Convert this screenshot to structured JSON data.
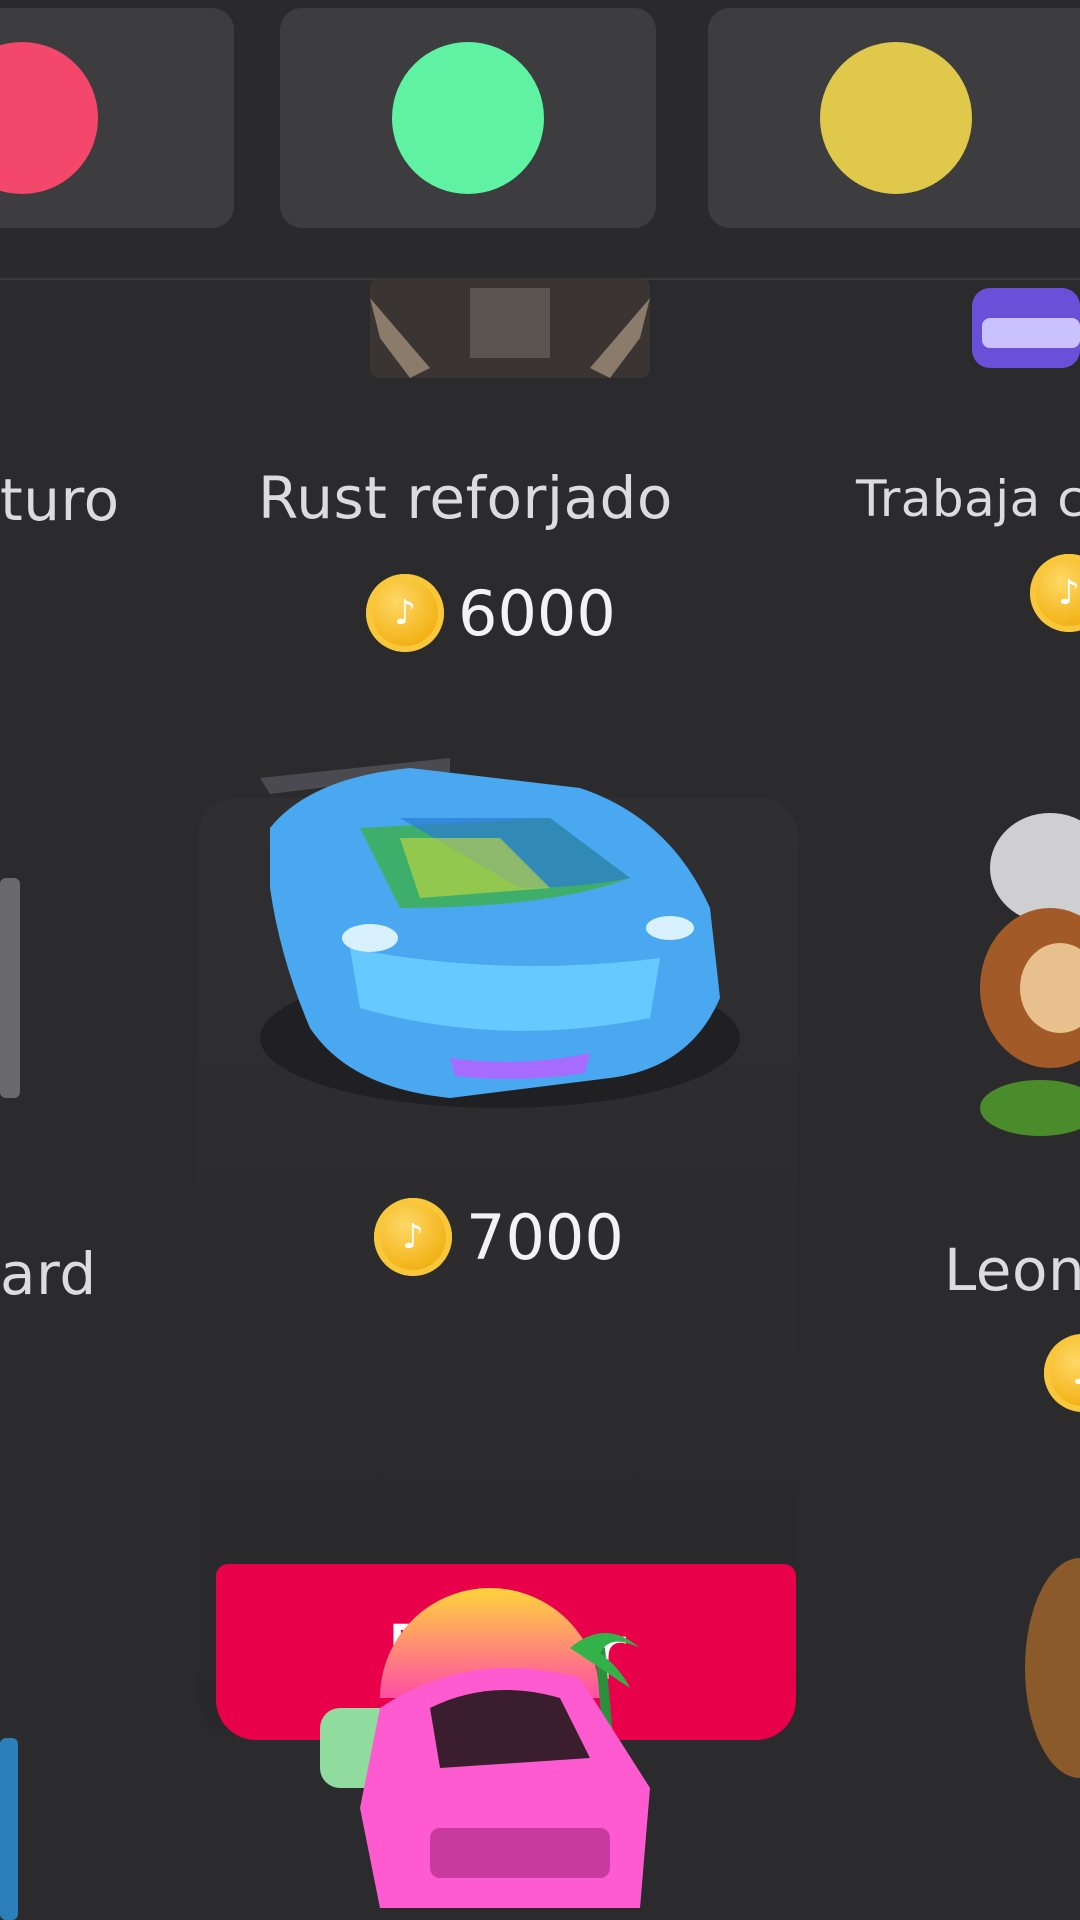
{
  "colors": {
    "red_dot": "#f3476b",
    "green_dot": "#5ef2a2",
    "yellow_dot": "#e0c84a",
    "send_button": "#e8004b"
  },
  "gifts_row1": {
    "left_partial_name": "turo",
    "middle": {
      "name": "Rust reforjado",
      "price": "6000"
    },
    "right_partial_name": "Trabaja c"
  },
  "gifts_row2": {
    "left_partial_name": "ard",
    "selected": {
      "price": "7000",
      "send_label": "Enviar"
    },
    "right_partial_name": "Leon"
  },
  "icons": {
    "coin": "tiktok-coin-icon"
  }
}
